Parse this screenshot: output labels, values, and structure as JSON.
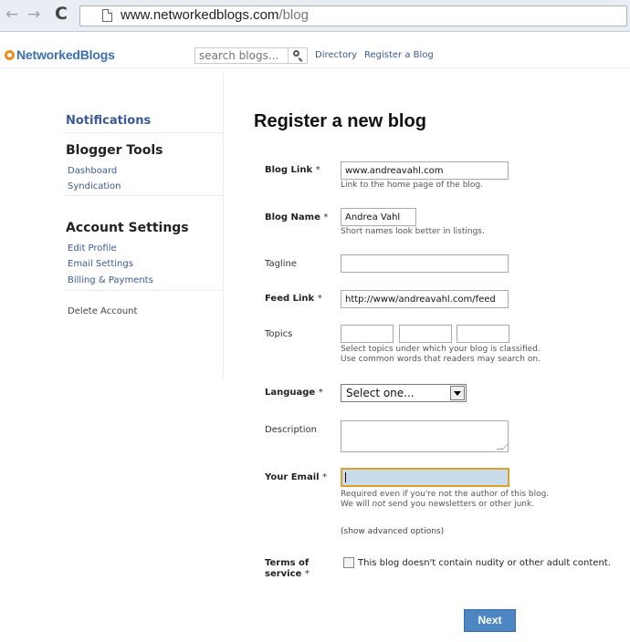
{
  "browser": {
    "url_host": "www.networkedblogs.com",
    "url_path": "/blog",
    "back_glyph": "←",
    "forward_glyph": "→",
    "reload_glyph": "C"
  },
  "header": {
    "logo": "NetworkedBlogs",
    "search_placeholder": "search blogs...",
    "links": [
      "Directory",
      "Register a Blog"
    ]
  },
  "sidebar": {
    "notifications": "Notifications",
    "blogger_tools": {
      "title": "Blogger Tools",
      "items": [
        "Dashboard",
        "Syndication"
      ]
    },
    "account_settings": {
      "title": "Account Settings",
      "items": [
        "Edit Profile",
        "Email Settings",
        "Billing & Payments"
      ]
    },
    "delete_account": "Delete Account"
  },
  "form": {
    "title": "Register a new blog",
    "required_marker": "*",
    "blog_link": {
      "label": "Blog Link",
      "value": "www.andreavahl.com",
      "hint": "Link to the home page of the blog."
    },
    "blog_name": {
      "label": "Blog Name",
      "value": "Andrea Vahl",
      "hint": "Short names look better in listings."
    },
    "tagline": {
      "label": "Tagline",
      "value": ""
    },
    "feed_link": {
      "label": "Feed Link",
      "value": "http://www/andreavahl.com/feed"
    },
    "topics": {
      "label": "Topics",
      "values": [
        "",
        "",
        ""
      ],
      "hint_line1": "Select topics under which your blog is classified.",
      "hint_line2": "Use common words that readers may search on."
    },
    "language": {
      "label": "Language",
      "selected": "Select one..."
    },
    "description": {
      "label": "Description",
      "value": ""
    },
    "email": {
      "label": "Your Email",
      "value": "",
      "hint_line1": "Required even if you're not the author of this blog.",
      "hint_line2_pre": "We will ",
      "hint_line2_em": "not",
      "hint_line2_post": " send you newsletters or other junk."
    },
    "advanced": "(show advanced options)",
    "terms": {
      "label_line1": "Terms of",
      "label_line2": "service",
      "checkbox_label": "This blog doesn't contain nudity or other adult content."
    },
    "next_button": "Next"
  },
  "colors": {
    "link": "#3b5998",
    "logo": "#3b6fb6",
    "logo_mark": "#f08c1c",
    "button": "#4d86c2",
    "email_focus_border": "#e0a030",
    "email_bg": "#c8dde9"
  }
}
